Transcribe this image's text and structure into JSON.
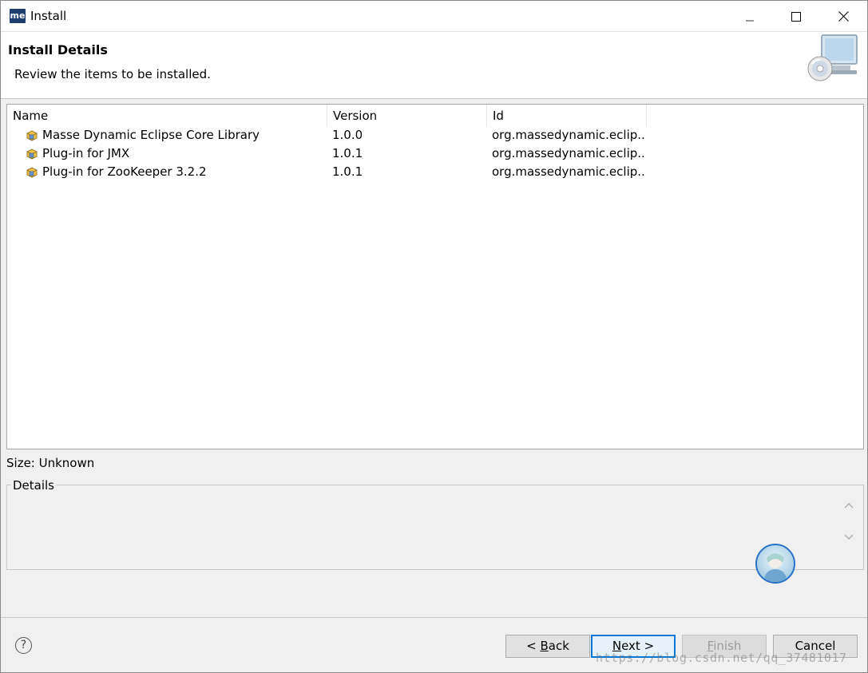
{
  "window": {
    "app_icon_text": "me",
    "title": "Install",
    "controls": {
      "minimize": "—",
      "maximize": "☐",
      "close": "✕"
    }
  },
  "header": {
    "title": "Install Details",
    "subtitle": "Review the items to be installed."
  },
  "table": {
    "columns": [
      "Name",
      "Version",
      "Id"
    ],
    "rows": [
      {
        "name": "Masse Dynamic Eclipse Core Library",
        "version": "1.0.0",
        "id": "org.massedynamic.eclip..."
      },
      {
        "name": "Plug-in for JMX",
        "version": "1.0.1",
        "id": "org.massedynamic.eclip..."
      },
      {
        "name": "Plug-in for ZooKeeper 3.2.2",
        "version": "1.0.1",
        "id": "org.massedynamic.eclip..."
      }
    ],
    "row_icon": "plugin-feature-icon"
  },
  "size_label": "Size: Unknown",
  "details": {
    "legend": "Details",
    "text": ""
  },
  "footer": {
    "help_icon": "question-icon",
    "help_glyph": "?",
    "back": {
      "prefix": "< ",
      "mnemonic": "B",
      "rest": "ack"
    },
    "next": {
      "mnemonic": "N",
      "rest": "ext >"
    },
    "finish": {
      "mnemonic": "F",
      "rest": "inish"
    },
    "cancel": "Cancel"
  },
  "watermark": "https://blog.csdn.net/qq_37481017",
  "colors": {
    "focus_border": "#0078d7",
    "app_icon_bg": "#1f3f73"
  }
}
